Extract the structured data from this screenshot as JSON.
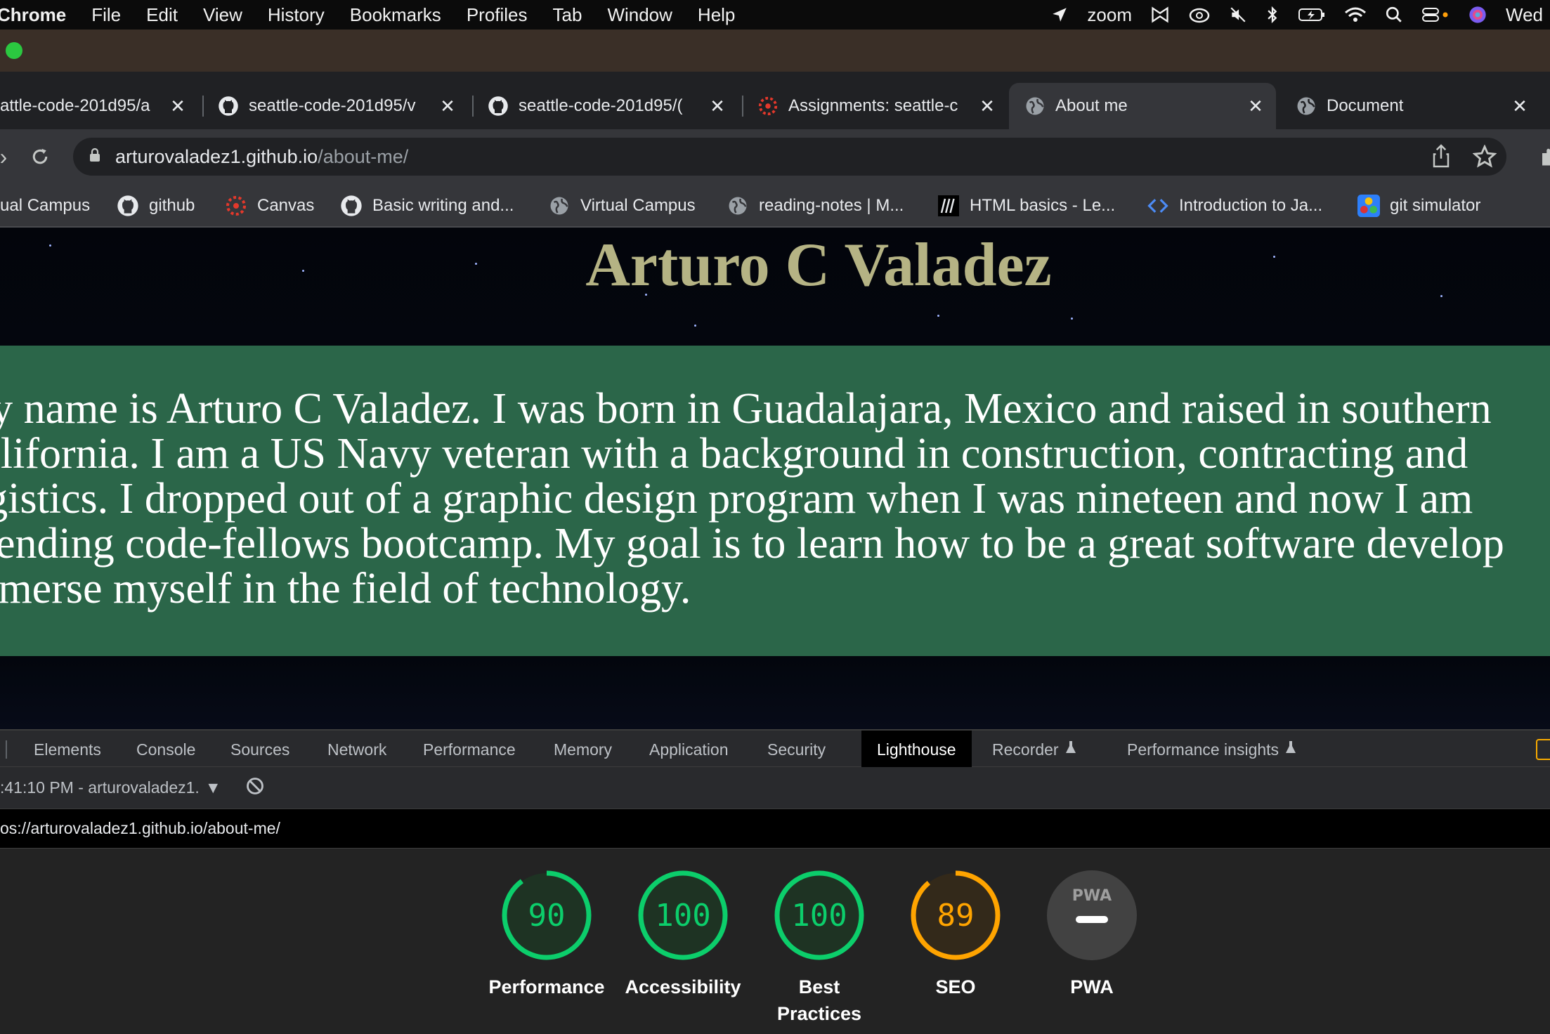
{
  "menubar": {
    "app": "Chrome",
    "items": [
      "File",
      "Edit",
      "View",
      "History",
      "Bookmarks",
      "Profiles",
      "Tab",
      "Window",
      "Help"
    ],
    "zoom_label": "zoom",
    "clock": "Wed"
  },
  "tabs": [
    {
      "title": "attle-code-201d95/a",
      "icon": "partial-tab"
    },
    {
      "title": "seattle-code-201d95/v",
      "icon": "github-icon"
    },
    {
      "title": "seattle-code-201d95/(",
      "icon": "github-icon"
    },
    {
      "title": "Assignments: seattle-c",
      "icon": "canvas-icon"
    },
    {
      "title": "About me",
      "icon": "globe-icon",
      "active": true
    },
    {
      "title": "Document",
      "icon": "globe-icon"
    }
  ],
  "omnibox": {
    "host": "arturovaladez1.github.io",
    "path": "/about-me/"
  },
  "bookmarks": [
    {
      "label": "ual Campus",
      "icon": "none"
    },
    {
      "label": "github",
      "icon": "github-icon"
    },
    {
      "label": "Canvas",
      "icon": "canvas-icon"
    },
    {
      "label": "Basic writing and...",
      "icon": "github-icon"
    },
    {
      "label": "Virtual Campus",
      "icon": "globe-icon"
    },
    {
      "label": "reading-notes | M...",
      "icon": "globe-icon"
    },
    {
      "label": "HTML basics - Le...",
      "icon": "mdn-icon"
    },
    {
      "label": "Introduction to Ja...",
      "icon": "code-icon"
    },
    {
      "label": "git simulator",
      "icon": "git-sim-icon"
    }
  ],
  "page": {
    "title": "Arturo C Valadez",
    "about_lines": [
      "My name is Arturo C Valadez. I was born in Guadalajara, Mexico and raised in southern",
      "California. I am a US Navy veteran with a background in construction, contracting and",
      "logistics. I dropped out of a graphic design program when I was nineteen and now I am",
      "attending code-fellows bootcamp. My goal is to learn how to be a great software develop",
      "immerse myself in the field of technology."
    ],
    "colors": {
      "title": "#b5b384",
      "section_bg": "#2b6649"
    }
  },
  "devtools": {
    "tabs": [
      "Elements",
      "Console",
      "Sources",
      "Network",
      "Performance",
      "Memory",
      "Application",
      "Security",
      "Lighthouse",
      "Recorder",
      "Performance insights"
    ],
    "active_tab": "Lighthouse",
    "report_selector": ":41:10 PM - arturovaladez1.",
    "report_url": "os://arturovaladez1.github.io/about-me/",
    "scores": [
      {
        "label": "Performance",
        "score": "90",
        "fraction": 0.9,
        "color": "#0cce6b"
      },
      {
        "label": "Accessibility",
        "score": "100",
        "fraction": 1.0,
        "color": "#0cce6b"
      },
      {
        "label": "Best Practices",
        "score": "100",
        "fraction": 1.0,
        "color": "#0cce6b"
      },
      {
        "label": "SEO",
        "score": "89",
        "fraction": 0.89,
        "color": "#ffa400"
      },
      {
        "label": "PWA",
        "score": "",
        "fraction": 0,
        "color": "#5f6368",
        "badge": "PWA"
      }
    ]
  }
}
